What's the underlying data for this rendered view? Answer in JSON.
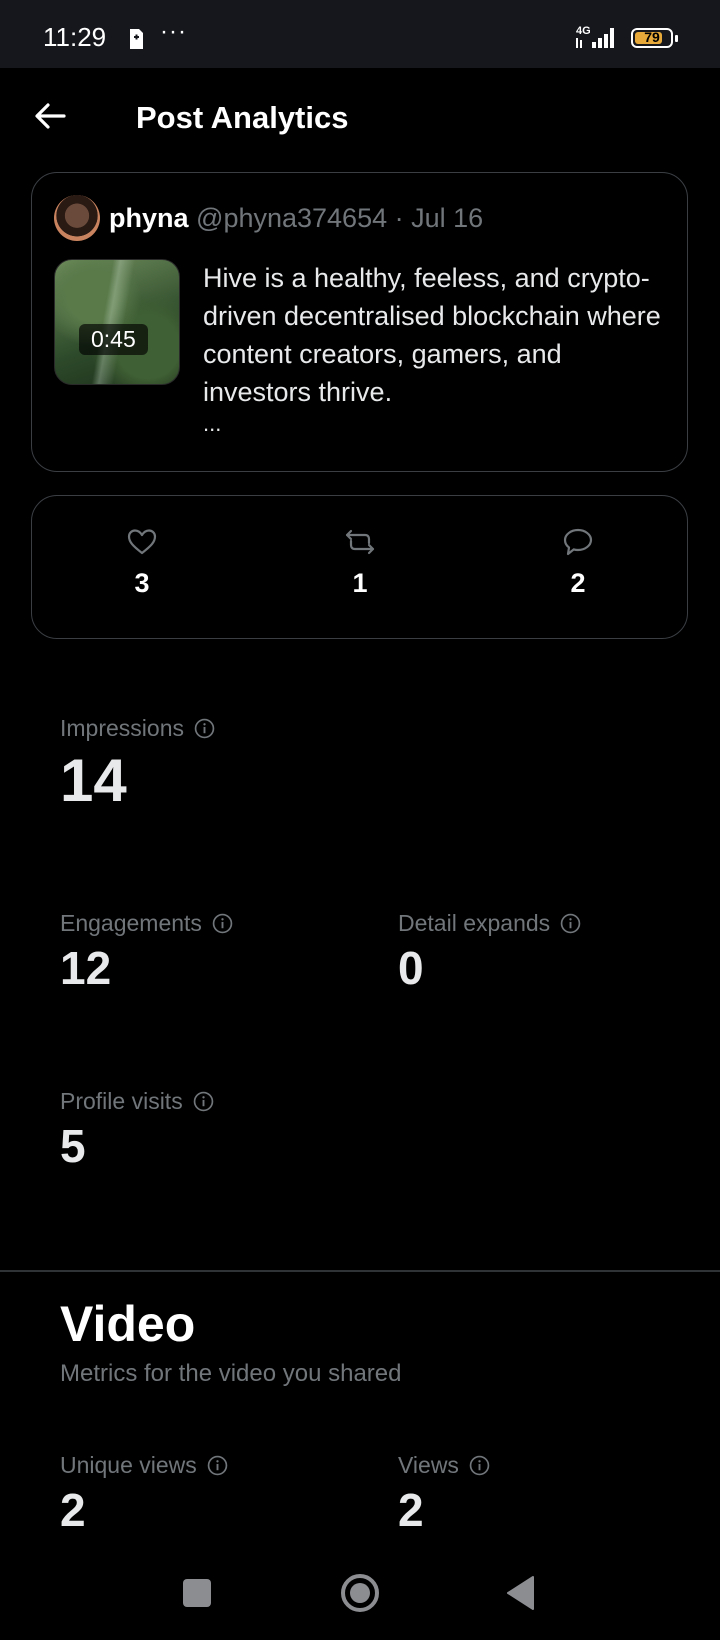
{
  "status_bar": {
    "time": "11:29",
    "overflow": "···",
    "network": "4G",
    "battery": "79",
    "battery_level_percent": 79,
    "battery_color": "#e6a93a"
  },
  "header": {
    "title": "Post Analytics",
    "back_icon": "arrow-left-icon"
  },
  "post": {
    "author_name": "phyna",
    "author_handle": "@phyna374654",
    "separator": "·",
    "date": "Jul 16",
    "video_duration": "0:45",
    "text": "Hive is a healthy, feeless, and crypto-driven decentralised blockchain where content creators, gamers, and investors thrive.",
    "ellipsis": "..."
  },
  "engagement": {
    "likes": "3",
    "reposts": "1",
    "replies": "2"
  },
  "metrics": {
    "impressions": {
      "label": "Impressions",
      "value": "14"
    },
    "engagements": {
      "label": "Engagements",
      "value": "12"
    },
    "detail_expands": {
      "label": "Detail expands",
      "value": "0"
    },
    "profile_visits": {
      "label": "Profile visits",
      "value": "5"
    }
  },
  "video_section": {
    "title": "Video",
    "subtitle": "Metrics for the video you shared",
    "unique_views": {
      "label": "Unique views",
      "value": "2"
    },
    "views": {
      "label": "Views",
      "value": "2"
    }
  },
  "nav": {
    "recents_icon": "square-icon",
    "home_icon": "circle-icon",
    "back_icon": "triangle-back-icon"
  },
  "colors": {
    "background": "#000000",
    "text_primary": "#e7e9ea",
    "text_secondary": "#71767b",
    "border": "#3b3f44"
  }
}
